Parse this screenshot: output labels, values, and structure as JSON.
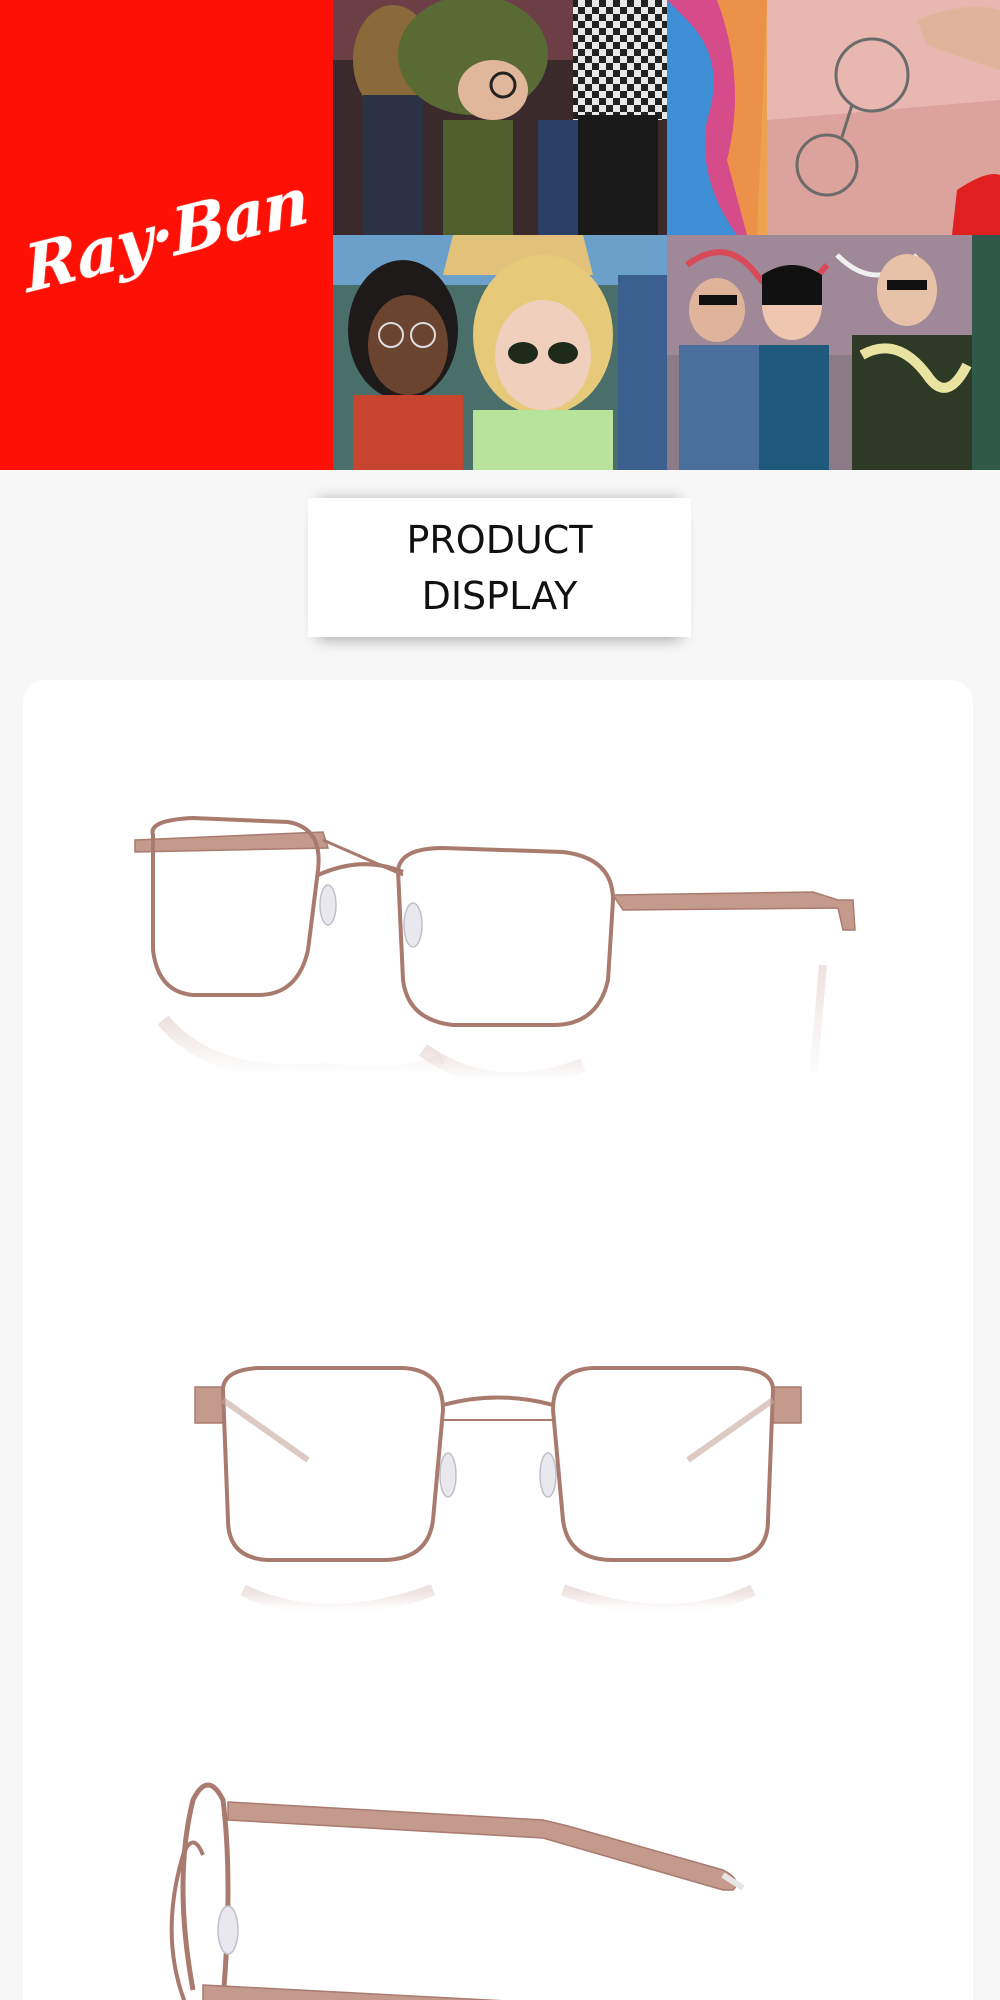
{
  "brand": {
    "logo_text": "Ray·Ban",
    "background_color": "#ff1005"
  },
  "hero": {
    "photos": [
      {
        "name": "party-crowd-photo"
      },
      {
        "name": "dropped-glasses-photo"
      },
      {
        "name": "friends-selfie-photo"
      },
      {
        "name": "graffiti-wall-group-photo"
      }
    ]
  },
  "section": {
    "heading": "PRODUCT DISPLAY"
  },
  "product": {
    "frame_color": "#b88a7f",
    "views": [
      {
        "name": "three-quarter-view"
      },
      {
        "name": "front-view"
      },
      {
        "name": "side-view"
      }
    ]
  }
}
